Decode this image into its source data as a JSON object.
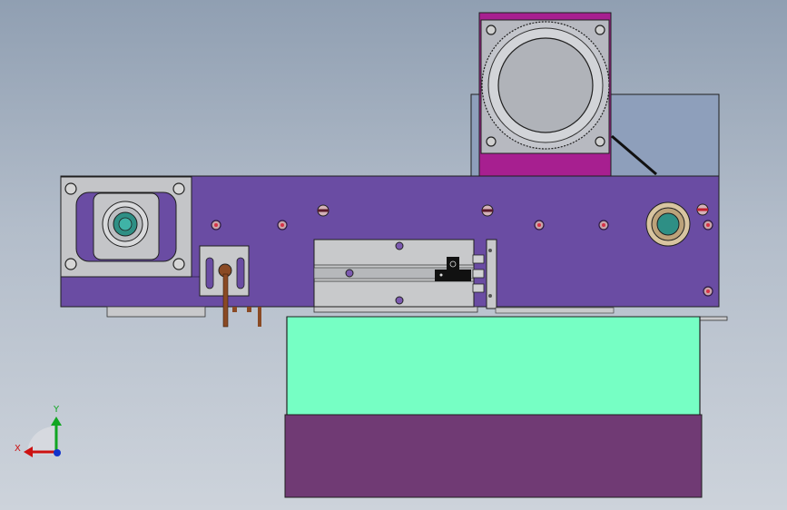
{
  "viewport": {
    "background_top": "#909fb2",
    "background_bottom": "#cdd3db"
  },
  "colors": {
    "base_plate": "#6a4ca3",
    "motor_flange": "#a71f90",
    "gray_block": "#8e9fbb",
    "cover_box": "#76ffc4",
    "bottom_box": "#703a74",
    "metal": "#c8c9cb",
    "copper": "#8a4a24",
    "outline": "#1f1f1f"
  },
  "triad": {
    "x_label": "X",
    "y_label": "Y",
    "x_color": "#cc1111",
    "y_color": "#11a622",
    "z_color": "#1133cc"
  }
}
